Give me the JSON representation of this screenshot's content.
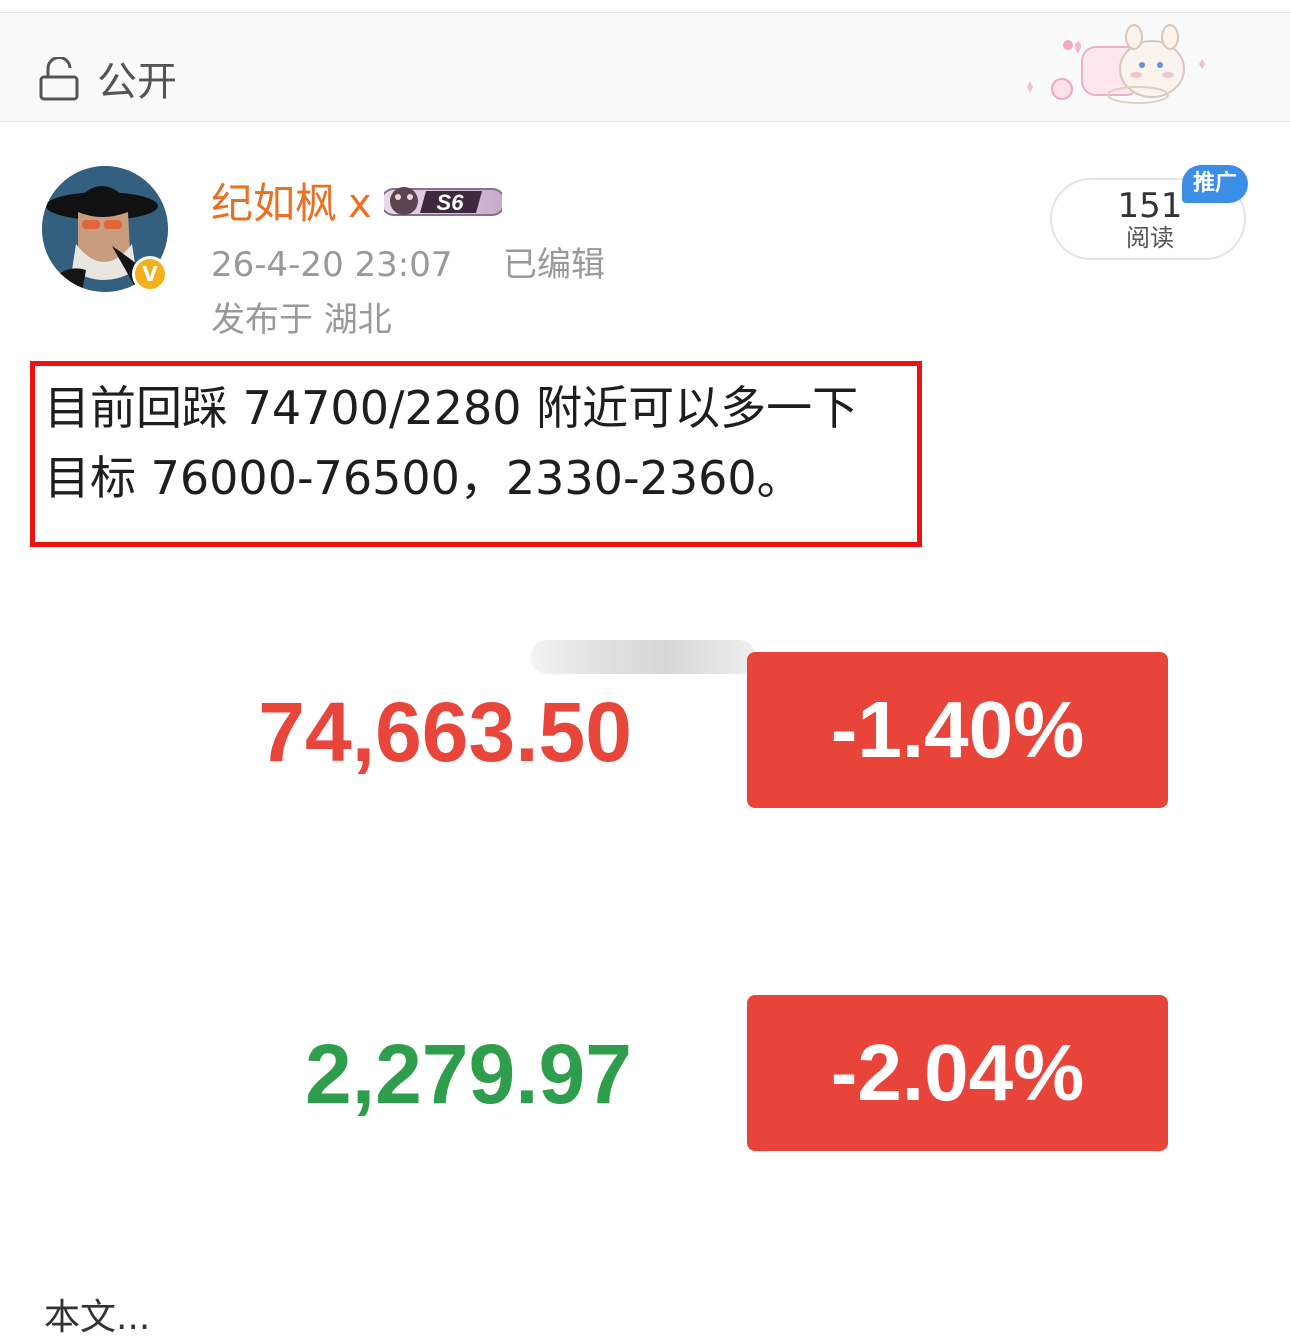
{
  "header": {
    "visibility_label": "公开",
    "lock_icon": "lock-open-icon",
    "sticker_icon": "bunny-sticker-icon"
  },
  "post": {
    "author": {
      "name": "纪如枫",
      "name_suffix": "x",
      "verified_badge": "V",
      "medal_text": "S6"
    },
    "timestamp": "26-4-20 23:07",
    "edited_label": "已编辑",
    "location": "发布于 湖北",
    "read_count": "151",
    "read_label": "阅读",
    "promo_label": "推广",
    "text_lines": [
      "目前回踩 74700/2280 附近可以多一下",
      "目标 76000-76500，2330-2360。"
    ]
  },
  "quotes": [
    {
      "price": "74,663.50",
      "change": "-1.40%",
      "price_color": "#e8463b"
    },
    {
      "price": "2,279.97",
      "change": "-2.04%",
      "price_color": "#2f9e4c"
    }
  ],
  "colors": {
    "username": "#eb7024",
    "highlight_border": "#ee1111",
    "change_box": "#e8443a",
    "promo_badge": "#3b8de5"
  },
  "footer": {
    "partial_text": "本文..."
  }
}
